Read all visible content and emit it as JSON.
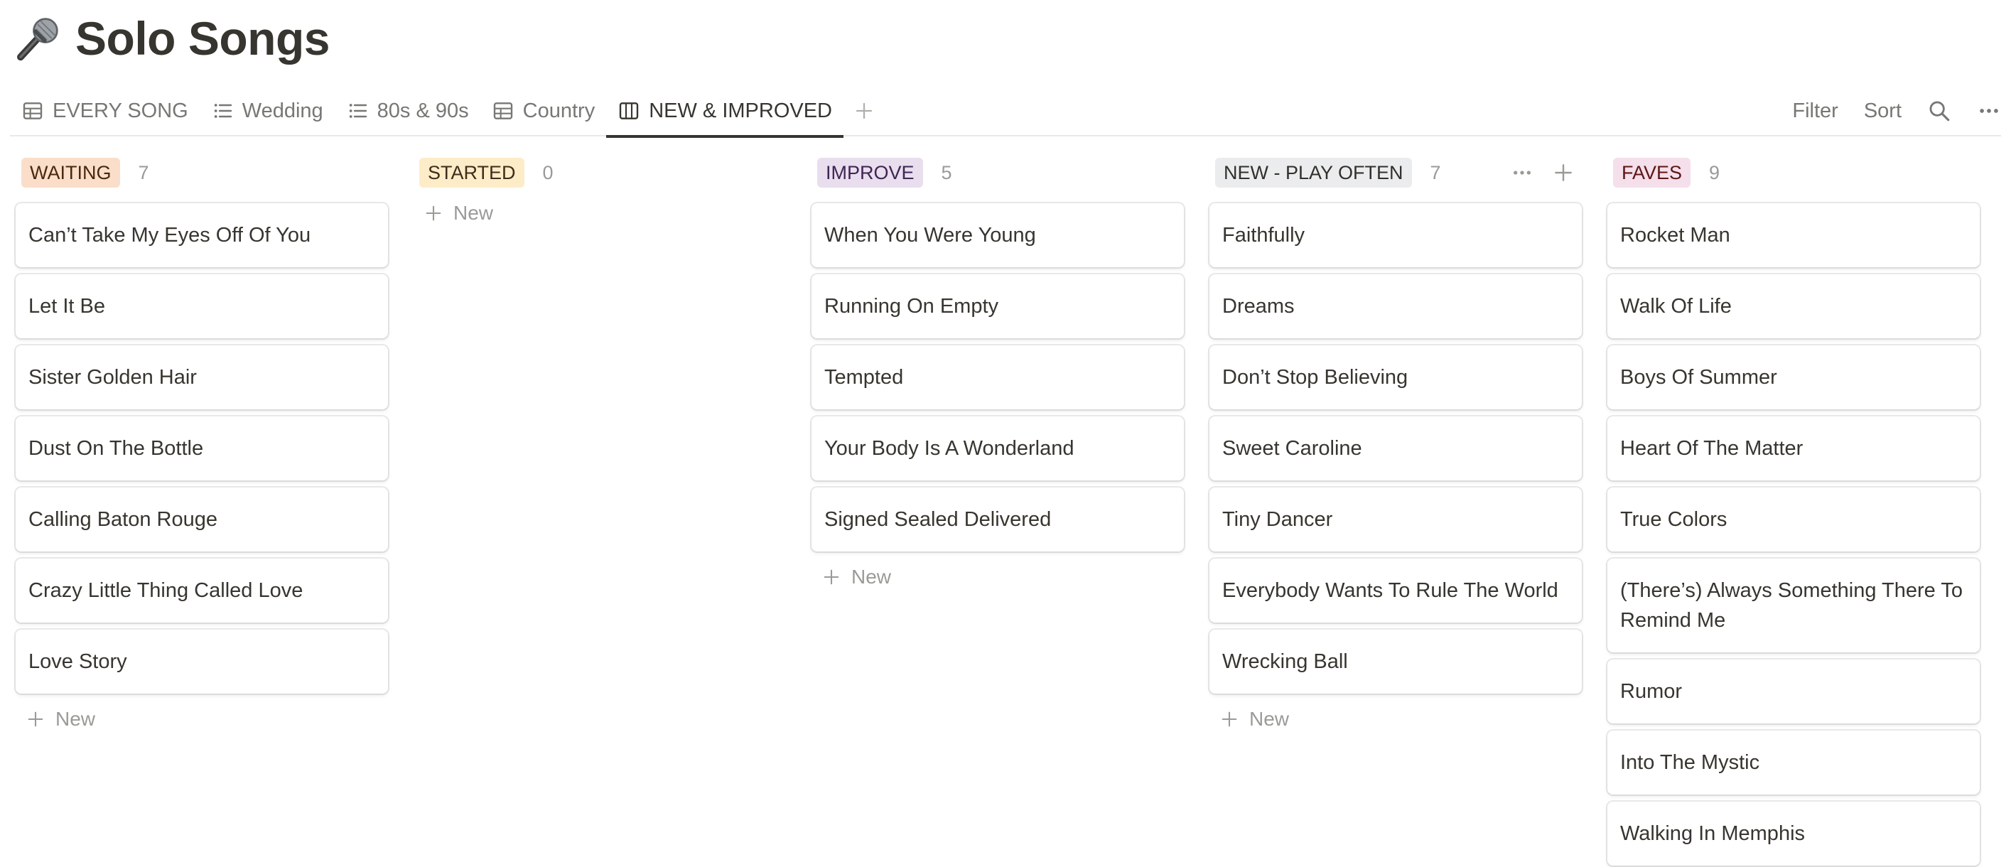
{
  "page": {
    "title": "Solo Songs",
    "icon": "microphone-icon"
  },
  "tabs": [
    {
      "label": "EVERY SONG",
      "icon": "table-icon",
      "active": false
    },
    {
      "label": "Wedding",
      "icon": "list-icon",
      "active": false
    },
    {
      "label": "80s & 90s",
      "icon": "list-icon",
      "active": false
    },
    {
      "label": "Country",
      "icon": "table-icon",
      "active": false
    },
    {
      "label": "NEW & IMPROVED",
      "icon": "board-icon",
      "active": true
    }
  ],
  "toolbar": {
    "filter_label": "Filter",
    "sort_label": "Sort",
    "search_icon": "search-icon",
    "more_icon": "more-icon"
  },
  "board": {
    "new_label": "New",
    "columns": [
      {
        "title": "WAITING",
        "count": "7",
        "badge_bg": "#fadec9",
        "badge_fg": "#49290e",
        "cards": [
          "Can’t Take My Eyes Off Of You",
          "Let It Be",
          "Sister Golden Hair",
          "Dust On The Bottle",
          "Calling Baton Rouge",
          "Crazy Little Thing Called Love",
          "Love Story"
        ]
      },
      {
        "title": "STARTED",
        "count": "0",
        "badge_bg": "#fdecc8",
        "badge_fg": "#402c1b",
        "cards": []
      },
      {
        "title": "IMPROVE",
        "count": "5",
        "badge_bg": "#e8deee",
        "badge_fg": "#412454",
        "cards": [
          "When You Were Young",
          "Running On Empty",
          "Tempted",
          "Your Body Is A Wonderland",
          "Signed Sealed Delivered"
        ]
      },
      {
        "title": "NEW - PLAY OFTEN",
        "count": "7",
        "badge_bg": "#ebeced",
        "badge_fg": "#32302c",
        "cards": [
          "Faithfully",
          "Dreams",
          "Don’t Stop Believing",
          "Sweet Caroline",
          "Tiny Dancer",
          "Everybody Wants To Rule The World",
          "Wrecking Ball"
        ]
      },
      {
        "title": "FAVES",
        "count": "9",
        "badge_bg": "#f4dfeb",
        "badge_fg": "#5d1715",
        "cards": [
          "Rocket Man",
          "Walk Of Life",
          "Boys Of Summer",
          "Heart Of The Matter",
          "True Colors",
          "(There’s) Always Something There To Remind Me",
          "Rumor",
          "Into The Mystic",
          "Walking In Memphis"
        ]
      }
    ]
  }
}
